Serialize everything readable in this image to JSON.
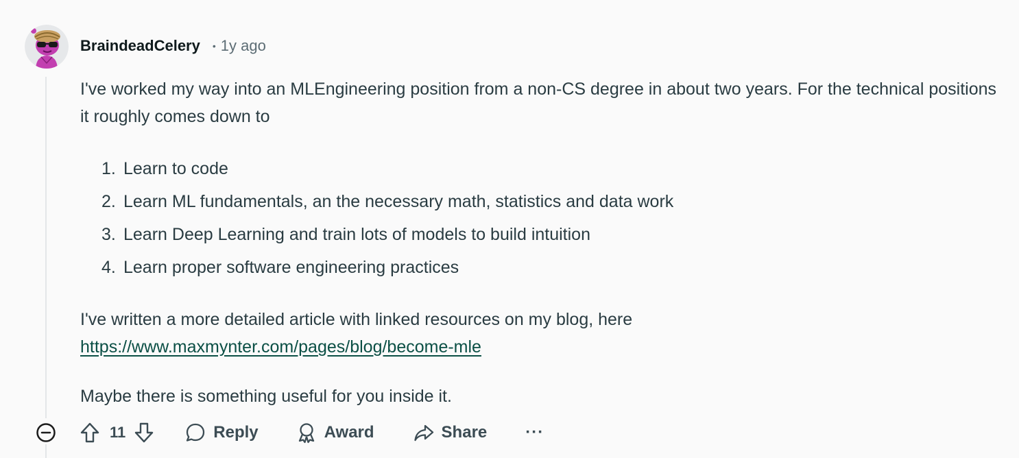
{
  "comment": {
    "author": "BraindeadCelery",
    "separator": "•",
    "timestamp": "1y ago",
    "intro": "I've worked my way into an MLEngineering position from a non-CS degree in about two years. For the technical positions it roughly comes down to",
    "list": [
      {
        "num": "1.",
        "text": "Learn to code"
      },
      {
        "num": "2.",
        "text": "Learn ML fundamentals, an the necessary math, statistics and data work"
      },
      {
        "num": "3.",
        "text": "Learn Deep Learning and train lots of models to build intuition"
      },
      {
        "num": "4.",
        "text": "Learn proper software engineering practices"
      }
    ],
    "blog_text": "I've written a more detailed article with linked resources on my blog, here",
    "blog_link": "https://www.maxmynter.com/pages/blog/become-mle",
    "closing": "Maybe there is something useful for you inside it."
  },
  "actions": {
    "score": "11",
    "reply_label": "Reply",
    "award_label": "Award",
    "share_label": "Share",
    "more_label": "···"
  },
  "icons": {
    "avatar": "snoo-avatar-icon",
    "collapse": "minus-circle-icon",
    "upvote": "arrow-up-icon",
    "downvote": "arrow-down-icon",
    "reply": "speech-bubble-icon",
    "award": "ribbon-icon",
    "share": "share-arrow-icon",
    "more": "ellipsis-icon"
  },
  "colors": {
    "background": "#fafafa",
    "text": "#2a3c42",
    "username": "#0f1a1c",
    "meta": "#5c6c74",
    "link": "#0b4f45",
    "thread_line": "#e3e6e8"
  }
}
